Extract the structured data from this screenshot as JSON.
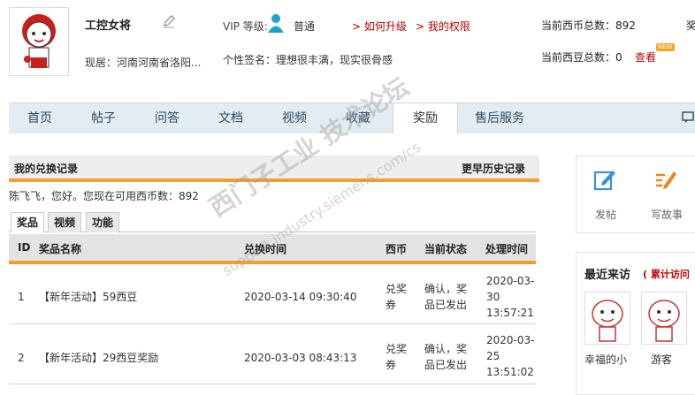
{
  "profile": {
    "name": "工控女将",
    "location": "现居：河南河南省洛阳...",
    "vip_label": "VIP 等级:",
    "vip_level": "普通",
    "upgrade_link": "> 如何升级",
    "rights_link": "> 我的权限",
    "signature": "个性签名：理想很丰满，现实很骨感",
    "coins_text": "当前西币总数：892",
    "beans_text": "当前西豆总数：0",
    "view_link": "查看",
    "new_badge": "NEW",
    "cut_right": "奖"
  },
  "nav": {
    "items": [
      "首页",
      "帖子",
      "问答",
      "文档",
      "视频",
      "收藏",
      "奖励",
      "售后服务"
    ],
    "active": "奖励"
  },
  "records": {
    "title": "我的兑换记录",
    "more": "更早历史记录",
    "greeting": "陈飞飞，您好。您现在可用西币数：892",
    "subtabs": [
      "奖品",
      "视频",
      "功能"
    ],
    "headers": {
      "id": "ID",
      "name": "奖品名称",
      "time": "兑换时间",
      "coin": "西币",
      "status": "当前状态",
      "process": "处理时间"
    },
    "rows": [
      {
        "id": "1",
        "name": "【新年活动】59西豆",
        "time": "2020-03-14 09:30:40",
        "coin_a": "兑奖",
        "coin_b": "券",
        "status_a": "确认，奖",
        "status_b": "品已发出",
        "process_a": "2020-03-",
        "process_b": "30",
        "process_c": "13:57:21"
      },
      {
        "id": "2",
        "name": "【新年活动】29西豆奖励",
        "time": "2020-03-03 08:43:13",
        "coin_a": "兑奖",
        "coin_b": "券",
        "status_a": "确认，奖",
        "status_b": "品已发出",
        "process_a": "2020-03-",
        "process_b": "25",
        "process_c": "13:51:02"
      }
    ]
  },
  "side": {
    "post_label": "发帖",
    "story_label": "写故事",
    "visitors_title": "最近来访",
    "visitors_count": "( 累计访问",
    "visitors": [
      "幸福的小",
      "游客"
    ]
  },
  "watermark": {
    "main": "西门子工业  技术论坛",
    "sub": "support.industry.siemens.com/cs"
  },
  "colors": {
    "accent_orange": "#f59b2f",
    "link_red": "#b80000",
    "nav_bg": "#e2ecf1"
  }
}
